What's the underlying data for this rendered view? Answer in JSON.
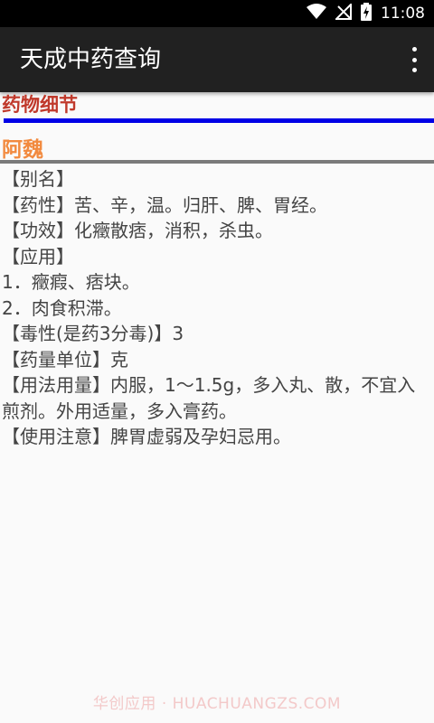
{
  "status_bar": {
    "time": "11:08",
    "icons": [
      "wifi-icon",
      "no-signal-icon",
      "battery-charging-icon"
    ]
  },
  "app_bar": {
    "title": "天成中药查询",
    "menu_icon": "overflow-menu-icon"
  },
  "content": {
    "section_title": "药物细节",
    "herb_name": "阿魏",
    "lines": [
      "【别名】",
      "【药性】苦、辛，温。归肝、脾、胃经。",
      "【功效】化癥散痞，消积，杀虫。",
      "【应用】",
      "1．癥瘕、痞块。",
      "2．肉食积滞。",
      "【毒性(是药3分毒)】3",
      "【药量单位】克",
      "【用法用量】内服，1～1.5g，多入丸、散，不宜入煎剂。外用适量，多入膏药。",
      "【使用注意】脾胃虚弱及孕妇忌用。"
    ]
  },
  "watermark": "华创应用 · HUACHUANGZS.COM",
  "colors": {
    "section_title": "#c0392b",
    "herb_name": "#f28a3f",
    "blue_divider": "#0000e6",
    "gray_divider": "#7a7a7a",
    "app_bar": "#212121"
  }
}
